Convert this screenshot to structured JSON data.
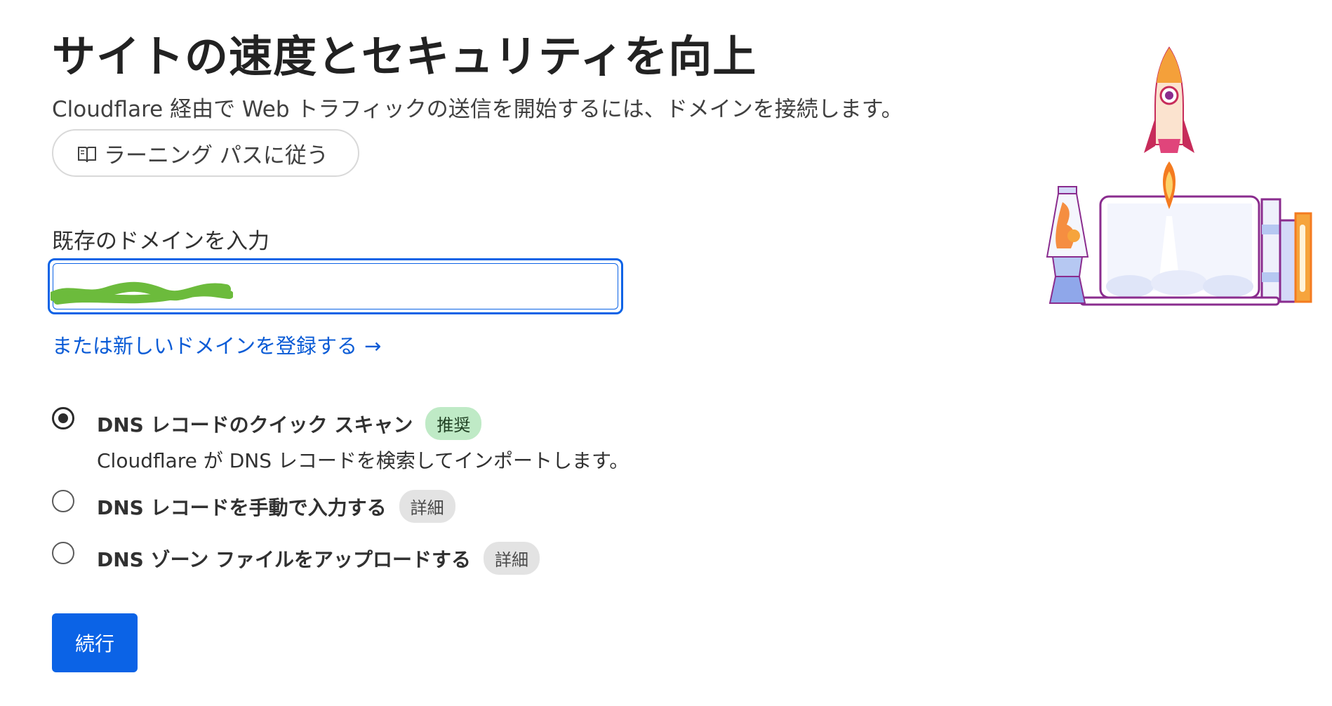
{
  "header": {
    "title": "サイトの速度とセキュリティを向上",
    "subtitle": "Cloudflare 経由で Web トラフィックの送信を開始するには、ドメインを接続します。"
  },
  "learning_path": {
    "label": "ラーニング パスに従う",
    "icon": "book-icon"
  },
  "domain_field": {
    "label": "既存のドメインを入力",
    "value": "",
    "redacted": true
  },
  "register_link": {
    "label": "または新しいドメインを登録する",
    "arrow": "→"
  },
  "options": [
    {
      "title": "DNS レコードのクイック スキャン",
      "badge": "推奨",
      "description": "Cloudflare が DNS レコードを検索してインポートします。",
      "checked": true
    },
    {
      "title": "DNS レコードを手動で入力する",
      "badge": "詳細",
      "checked": false
    },
    {
      "title": "DNS ゾーン ファイルをアップロードする",
      "badge": "詳細",
      "checked": false
    }
  ],
  "continue_label": "続行",
  "colors": {
    "primary": "#0b63e6",
    "link": "#0a5bd6",
    "badge_green": "#bfeac6",
    "badge_grey": "#e3e3e3"
  }
}
